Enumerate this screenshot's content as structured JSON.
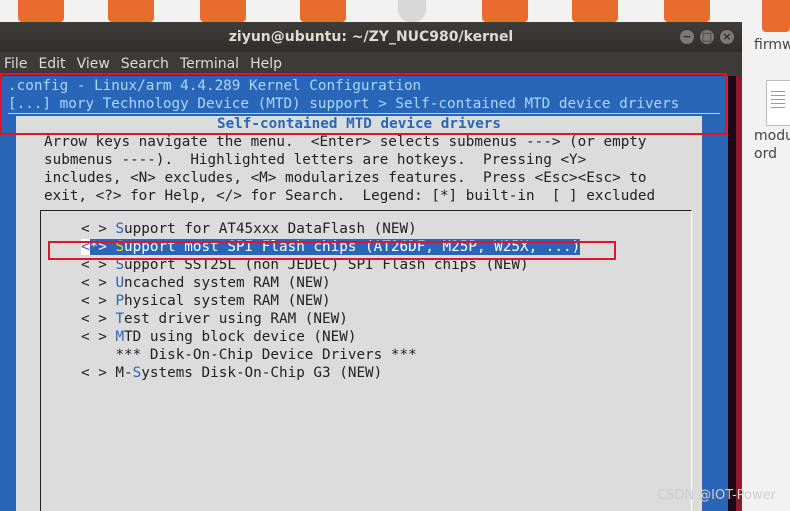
{
  "window": {
    "title": "ziyun@ubuntu: ~/ZY_NUC980/kernel",
    "controls": {
      "close": "×",
      "minimize": "−",
      "maximize": "□"
    }
  },
  "menubar": [
    "File",
    "Edit",
    "View",
    "Search",
    "Terminal",
    "Help"
  ],
  "desktop": {
    "right_labels": [
      "firmw",
      "modu",
      "ord"
    ]
  },
  "terminal": {
    "header_line1": ".config - Linux/arm 4.4.289 Kernel Configuration",
    "header_line2": "[...] mory Technology Device (MTD) support > Self-contained MTD device drivers",
    "dialog_title": "Self-contained MTD device drivers",
    "help_lines": [
      "Arrow keys navigate the menu.  <Enter> selects submenus ---> (or empty",
      "submenus ----).  Highlighted letters are hotkeys.  Pressing <Y>",
      "includes, <N> excludes, <M> modularizes features.  Press <Esc><Esc> to",
      "exit, <?> for Help, </> for Search.  Legend: [*] built-in  [ ] excluded"
    ],
    "items": [
      {
        "prefix": "< > ",
        "hot": "S",
        "rest": "upport for AT45xxx DataFlash (NEW)",
        "selected": false
      },
      {
        "prefix": "<*> ",
        "hot": "S",
        "rest": "upport most SPI Flash chips (AT26DF, M25P, W25X, ...)",
        "selected": true
      },
      {
        "prefix": "< > ",
        "hot": "S",
        "rest": "upport SST25L (non JEDEC) SPI Flash chips (NEW)",
        "selected": false
      },
      {
        "prefix": "< > ",
        "hot": "U",
        "rest": "ncached system RAM (NEW)",
        "selected": false
      },
      {
        "prefix": "< > ",
        "hot": "P",
        "rest": "hysical system RAM (NEW)",
        "selected": false
      },
      {
        "prefix": "< > ",
        "hot": "T",
        "rest": "est driver using RAM (NEW)",
        "selected": false
      },
      {
        "prefix": "< > ",
        "hot": "M",
        "rest": "TD using block device (NEW)",
        "selected": false
      },
      {
        "prefix": "    ",
        "hot": "",
        "rest": "*** Disk-On-Chip Device Drivers ***",
        "selected": false
      },
      {
        "prefix": "< > M-",
        "hot": "S",
        "rest": "ystems Disk-On-Chip G3 (NEW)",
        "selected": false
      }
    ]
  },
  "watermark": "CSDN @IOT-Power",
  "colors": {
    "terminal_bg": "#300a24",
    "menuconfig_blue": "#2a66b8",
    "dialog_gray": "#dcdcdc",
    "annotation_red": "#e0142a",
    "hotkey_yellow": "#ffd000"
  }
}
